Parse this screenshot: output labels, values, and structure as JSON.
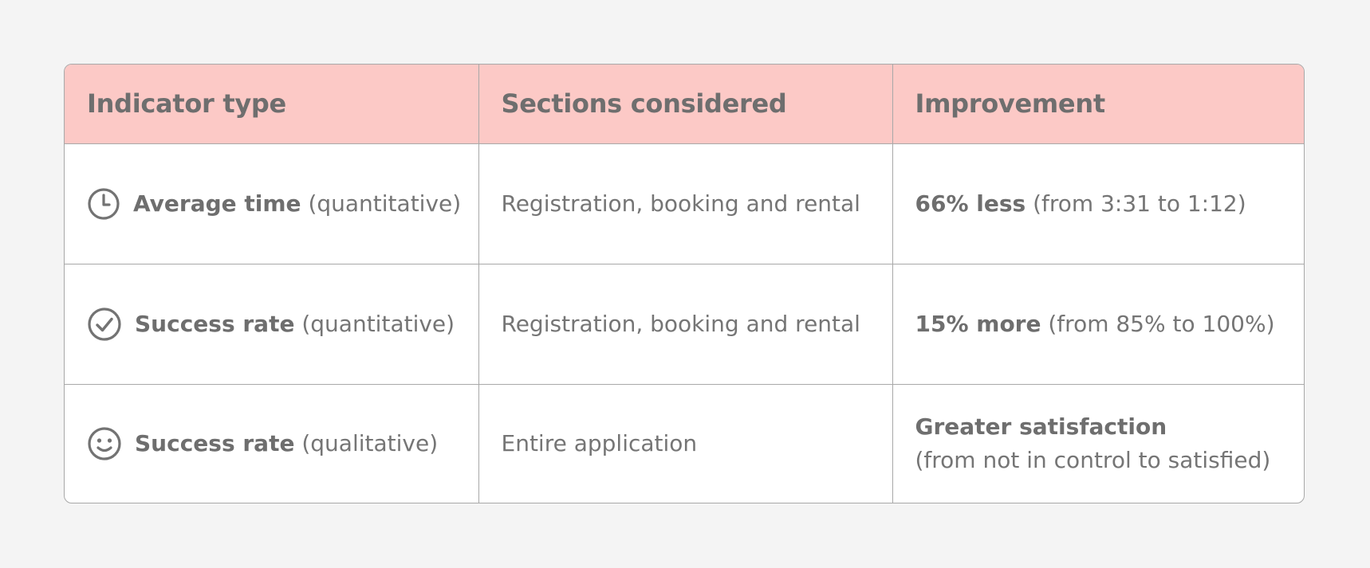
{
  "table": {
    "headers": [
      "Indicator type",
      "Sections considered",
      "Improvement"
    ],
    "rows": [
      {
        "icon": "clock-icon",
        "indicator_bold": "Average time",
        "indicator_rest": " (quantitative)",
        "sections": "Registration, booking and rental",
        "improvement_bold": "66% less",
        "improvement_rest": " (from 3:31 to 1:12)"
      },
      {
        "icon": "check-circle-icon",
        "indicator_bold": "Success rate",
        "indicator_rest": " (quantitative)",
        "sections": "Registration, booking and rental",
        "improvement_bold": "15% more",
        "improvement_rest": " (from 85% to 100%)"
      },
      {
        "icon": "smiley-icon",
        "indicator_bold": "Success rate",
        "indicator_rest": " (qualitative)",
        "sections": "Entire application",
        "improvement_bold": "Greater satisfaction",
        "improvement_rest": "(from not in control to satisfied)"
      }
    ]
  },
  "colors": {
    "header_bg": "#fcc9c6",
    "page_bg": "#f4f4f4",
    "border": "#a8a8a8",
    "text": "#757575"
  }
}
